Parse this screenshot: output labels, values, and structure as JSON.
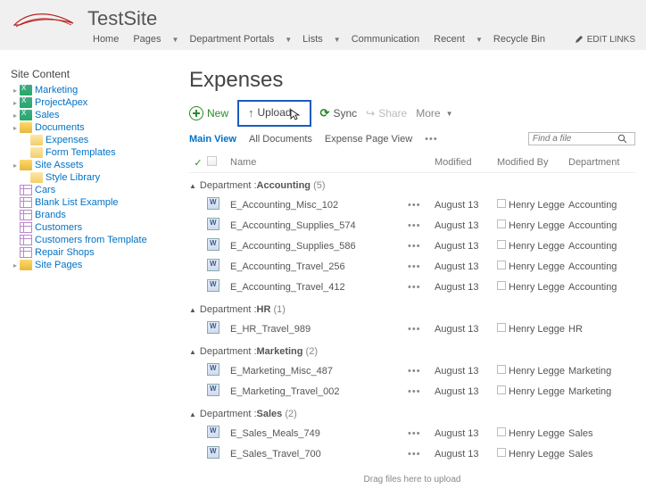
{
  "site": {
    "title": "TestSite"
  },
  "nav": {
    "items": [
      "Home",
      "Pages",
      "Department Portals",
      "Lists",
      "Communication",
      "Recent",
      "Recycle Bin"
    ],
    "dropdown_after": [
      2,
      3,
      5
    ],
    "edit_links": "EDIT LINKS"
  },
  "sidebar": {
    "heading": "Site Content",
    "items": [
      {
        "label": "Marketing",
        "icon": "green",
        "indent": 0,
        "caret": true
      },
      {
        "label": "ProjectApex",
        "icon": "green",
        "indent": 0,
        "caret": true
      },
      {
        "label": "Sales",
        "icon": "green",
        "indent": 0,
        "caret": true
      },
      {
        "label": "Documents",
        "icon": "yellow",
        "indent": 0,
        "caret": true
      },
      {
        "label": "Expenses",
        "icon": "folder",
        "indent": 1,
        "caret": false
      },
      {
        "label": "Form Templates",
        "icon": "folder",
        "indent": 1,
        "caret": false
      },
      {
        "label": "Site Assets",
        "icon": "yellow",
        "indent": 0,
        "caret": true
      },
      {
        "label": "Style Library",
        "icon": "folder",
        "indent": 1,
        "caret": false
      },
      {
        "label": "Cars",
        "icon": "grid",
        "indent": 0,
        "caret": false
      },
      {
        "label": "Blank List Example",
        "icon": "grid",
        "indent": 0,
        "caret": false
      },
      {
        "label": "Brands",
        "icon": "grid",
        "indent": 0,
        "caret": false
      },
      {
        "label": "Customers",
        "icon": "grid",
        "indent": 0,
        "caret": false
      },
      {
        "label": "Customers from Template",
        "icon": "grid",
        "indent": 0,
        "caret": false
      },
      {
        "label": "Repair Shops",
        "icon": "grid",
        "indent": 0,
        "caret": false
      },
      {
        "label": "Site Pages",
        "icon": "yellow",
        "indent": 0,
        "caret": true
      }
    ]
  },
  "page": {
    "title": "Expenses"
  },
  "actions": {
    "new": "New",
    "upload": "Upload",
    "sync": "Sync",
    "share": "Share",
    "more": "More"
  },
  "views": {
    "main": "Main View",
    "all": "All Documents",
    "expense": "Expense Page View",
    "search_placeholder": "Find a file"
  },
  "columns": {
    "name": "Name",
    "modified": "Modified",
    "modified_by": "Modified By",
    "department": "Department"
  },
  "group_prefix": "Department : ",
  "groups": [
    {
      "name": "Accounting",
      "count": "(5)",
      "rows": [
        {
          "name": "E_Accounting_Misc_102",
          "modified": "August 13",
          "by": "Henry Legge",
          "dept": "Accounting"
        },
        {
          "name": "E_Accounting_Supplies_574",
          "modified": "August 13",
          "by": "Henry Legge",
          "dept": "Accounting"
        },
        {
          "name": "E_Accounting_Supplies_586",
          "modified": "August 13",
          "by": "Henry Legge",
          "dept": "Accounting"
        },
        {
          "name": "E_Accounting_Travel_256",
          "modified": "August 13",
          "by": "Henry Legge",
          "dept": "Accounting"
        },
        {
          "name": "E_Accounting_Travel_412",
          "modified": "August 13",
          "by": "Henry Legge",
          "dept": "Accounting"
        }
      ]
    },
    {
      "name": "HR",
      "count": "(1)",
      "rows": [
        {
          "name": "E_HR_Travel_989",
          "modified": "August 13",
          "by": "Henry Legge",
          "dept": "HR"
        }
      ]
    },
    {
      "name": "Marketing",
      "count": "(2)",
      "rows": [
        {
          "name": "E_Marketing_Misc_487",
          "modified": "August 13",
          "by": "Henry Legge",
          "dept": "Marketing"
        },
        {
          "name": "E_Marketing_Travel_002",
          "modified": "August 13",
          "by": "Henry Legge",
          "dept": "Marketing"
        }
      ]
    },
    {
      "name": "Sales",
      "count": "(2)",
      "rows": [
        {
          "name": "E_Sales_Meals_749",
          "modified": "August 13",
          "by": "Henry Legge",
          "dept": "Sales"
        },
        {
          "name": "E_Sales_Travel_700",
          "modified": "August 13",
          "by": "Henry Legge",
          "dept": "Sales"
        }
      ]
    }
  ],
  "drag_hint": "Drag files here to upload"
}
